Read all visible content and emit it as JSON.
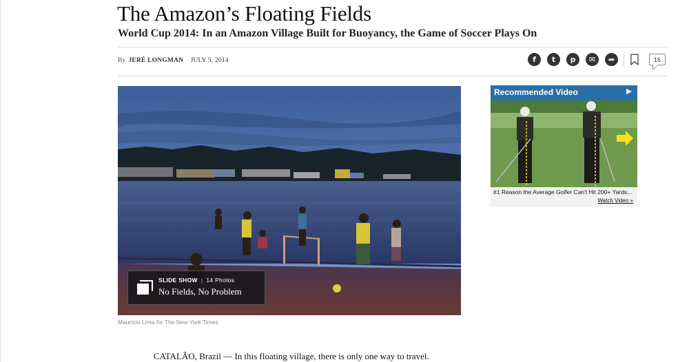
{
  "article": {
    "headline": "The Amazon’s Floating Fields",
    "summary": "World Cup 2014: In an Amazon Village Built for Buoyancy, the Game of Soccer Plays On",
    "byline_prefix": "By",
    "author": "JERÉ LONGMAN",
    "date": "JULY 5, 2014",
    "body_first_line": "CATALÃO, Brazil — In this floating village, there is only one way to travel."
  },
  "share": {
    "icons": [
      "facebook-icon",
      "twitter-icon",
      "pinterest-icon",
      "email-icon",
      "share-icon"
    ],
    "glyphs": [
      "f",
      "t",
      "p",
      "✉",
      "➦"
    ],
    "comment_count": "16"
  },
  "photo": {
    "slideshow_label": "SLIDE SHOW",
    "photo_count": "14 Photos",
    "slideshow_title": "No Fields, No Problem",
    "caption": "Maurício Lima for The New York Times"
  },
  "ad": {
    "title": "Recommended Video",
    "cta": "#1 Reason the Average Golfer Can't Hit 200+ Yards...",
    "watch": "Watch Video »"
  },
  "colors": {
    "icon_dark": "#333333",
    "ad_blue": "#2a6ea8",
    "ad_arrow": "#f5e21a"
  }
}
